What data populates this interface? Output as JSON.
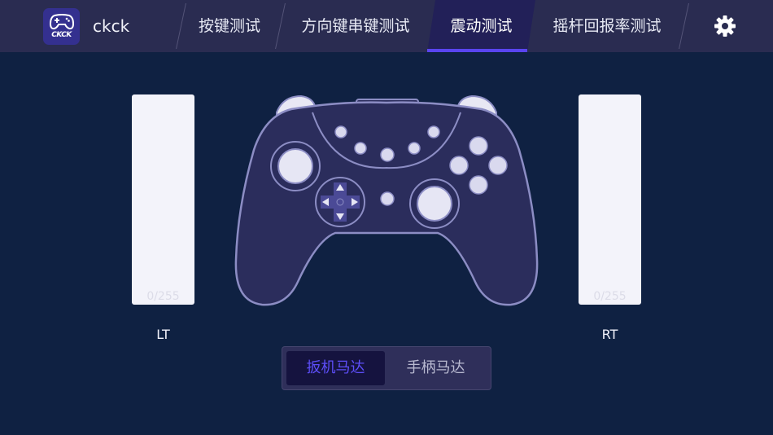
{
  "app": {
    "name": "ckck",
    "logo_text": "CKCK"
  },
  "tabs": [
    {
      "label": "按键测试",
      "active": false
    },
    {
      "label": "方向键串键测试",
      "active": false
    },
    {
      "label": "震动测试",
      "active": true
    },
    {
      "label": "摇杆回报率测试",
      "active": false
    }
  ],
  "triggers": {
    "left": {
      "label": "LT",
      "value": "0/255"
    },
    "right": {
      "label": "RT",
      "value": "0/255"
    }
  },
  "motor_toggle": {
    "options": [
      "扳机马达",
      "手柄马达"
    ],
    "selected": "扳机马达"
  },
  "colors": {
    "background": "#0f2142",
    "topbar": "#2a2c51",
    "accent": "#5a44f0",
    "controller_body": "#2b2d5c",
    "controller_outline": "#8c8dc4"
  },
  "icons": {
    "settings": "gear-icon",
    "logo": "gamepad-icon"
  }
}
